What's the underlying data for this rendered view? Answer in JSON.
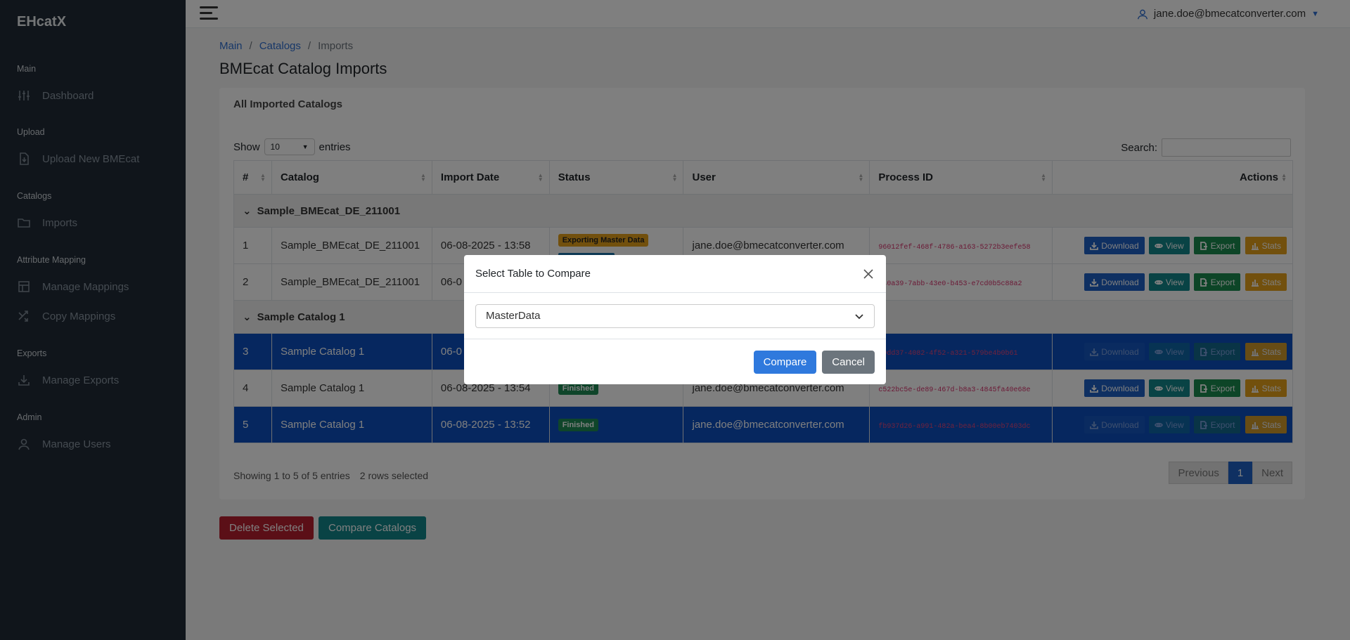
{
  "app": {
    "brand": "EHcatX"
  },
  "sidebar": {
    "sections": [
      {
        "title": "Main",
        "items": [
          {
            "label": "Dashboard",
            "icon": "sliders-icon"
          }
        ]
      },
      {
        "title": "Upload",
        "items": [
          {
            "label": "Upload New BMEcat",
            "icon": "file-upload-icon"
          }
        ]
      },
      {
        "title": "Catalogs",
        "items": [
          {
            "label": "Imports",
            "icon": "folder-icon"
          }
        ]
      },
      {
        "title": "Attribute Mapping",
        "items": [
          {
            "label": "Manage Mappings",
            "icon": "table-icon"
          },
          {
            "label": "Copy Mappings",
            "icon": "shuffle-icon"
          }
        ]
      },
      {
        "title": "Exports",
        "items": [
          {
            "label": "Manage Exports",
            "icon": "download-icon"
          }
        ]
      },
      {
        "title": "Admin",
        "items": [
          {
            "label": "Manage Users",
            "icon": "user-icon"
          }
        ]
      }
    ]
  },
  "header": {
    "user_email": "jane.doe@bmecatconverter.com"
  },
  "breadcrumb": {
    "items": [
      "Main",
      "Catalogs",
      "Imports"
    ],
    "sep": "/"
  },
  "page": {
    "title": "BMEcat Catalog Imports"
  },
  "card": {
    "title": "All Imported Catalogs",
    "show_label": "Show",
    "entries_value": "10",
    "entries_label": "entries",
    "search_label": "Search:"
  },
  "table": {
    "headers": [
      "#",
      "Catalog",
      "Import Date",
      "Status",
      "User",
      "Process ID",
      "Actions"
    ],
    "groups": [
      {
        "name": "Sample_BMEcat_DE_211001"
      },
      {
        "name": "Sample Catalog 1"
      }
    ],
    "rows": [
      {
        "num": "1",
        "catalog": "Sample_BMEcat_DE_211001",
        "date": "06-08-2025 - 13:58",
        "status": "Exporting Master Data",
        "user": "jane.doe@bmecatconverter.com",
        "pid": "96012fef-468f-4786-a163-5272b3eefe58"
      },
      {
        "num": "2",
        "catalog": "Sample_BMEcat_DE_211001",
        "date": "06-0",
        "status": "",
        "user": "",
        "pid": "d40a39-7abb-43e0-b453-e7cd0b5c88a2"
      },
      {
        "num": "3",
        "catalog": "Sample Catalog 1",
        "date": "06-0",
        "status": "",
        "user": "",
        "pid": "19dd37-4082-4f52-a321-579be4b0b61"
      },
      {
        "num": "4",
        "catalog": "Sample Catalog 1",
        "date": "06-08-2025 - 13:54",
        "status": "Finished",
        "user": "jane.doe@bmecatconverter.com",
        "pid": "c522bc5e-de89-467d-b8a3-4845fa40e68e"
      },
      {
        "num": "5",
        "catalog": "Sample Catalog 1",
        "date": "06-08-2025 - 13:52",
        "status": "Finished",
        "user": "jane.doe@bmecatconverter.com",
        "pid": "fb937d26-a991-482a-bea4-8b00eb7403dc"
      }
    ],
    "actions": {
      "download": "Download",
      "view": "View",
      "export": "Export",
      "stats": "Stats"
    }
  },
  "footer": {
    "info": "Showing 1 to 5 of 5 entries",
    "selected": "2 rows selected",
    "prev": "Previous",
    "page": "1",
    "next": "Next"
  },
  "buttons": {
    "delete": "Delete Selected",
    "compare": "Compare Catalogs"
  },
  "modal": {
    "title": "Select Table to Compare",
    "select_value": "MasterData",
    "compare": "Compare",
    "cancel": "Cancel"
  },
  "colors": {
    "primary": "#1f61c4",
    "selected_row": "#0d4fbf",
    "danger": "#b71f2f",
    "info": "#13868a",
    "success": "#1a8a4f",
    "warning": "#e4a01b",
    "sidebar": "#212b36"
  }
}
